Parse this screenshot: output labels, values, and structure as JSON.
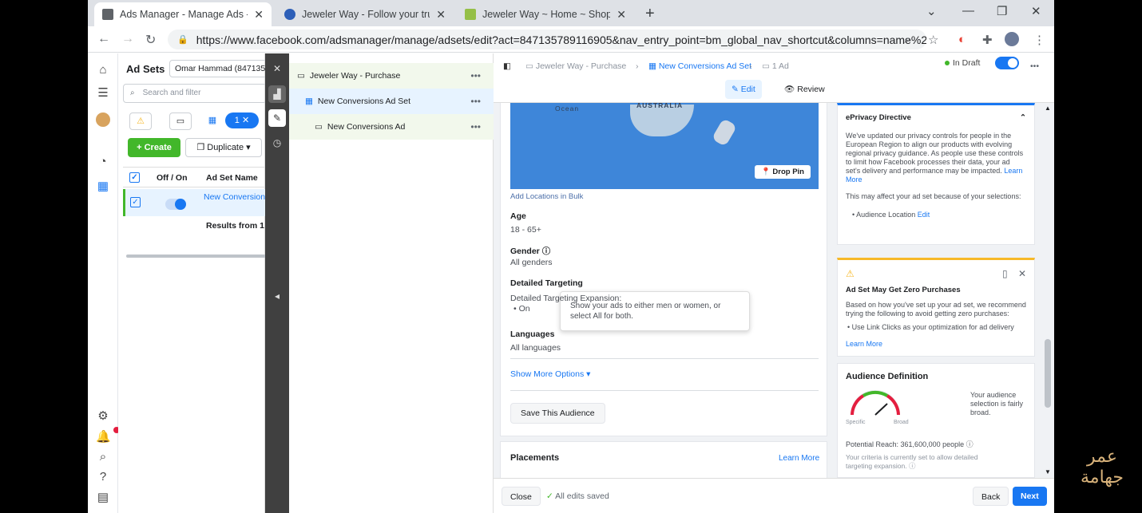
{
  "browser": {
    "tabs": [
      {
        "title": "Ads Manager - Manage Ads - Ad",
        "active": true
      },
      {
        "title": "Jeweler Way - Follow your true p",
        "active": false
      },
      {
        "title": "Jeweler Way ~ Home ~ Shopify",
        "active": false
      }
    ],
    "url": "https://www.facebook.com/adsmanager/manage/adsets/edit?act=847135789116905&nav_entry_point=bm_global_nav_shortcut&columns=name%2..."
  },
  "adsets_panel": {
    "title": "Ad Sets",
    "account": "Omar Hammad (8471357",
    "search_placeholder": "Search and filter",
    "filter_pill": "1",
    "create_label": "Create",
    "duplicate_label": "Duplicate",
    "col_off_on": "Off / On",
    "col_name": "Ad Set Name",
    "row_name": "New Conversion",
    "results": "Results from 1 a"
  },
  "tree": {
    "campaign": "Jeweler Way - Purchase",
    "adset": "New Conversions Ad Set",
    "ad": "New Conversions Ad"
  },
  "editor": {
    "crumb_campaign": "Jeweler Way - Purchase",
    "crumb_adset": "New Conversions Ad Set",
    "crumb_ad": "1 Ad",
    "status": "In Draft",
    "edit_label": "Edit",
    "review_label": "Review",
    "map_ocean": "Ocean",
    "map_australia": "AUSTRALIA",
    "drop_pin": "Drop Pin",
    "add_bulk": "Add Locations in Bulk",
    "age_label": "Age",
    "age_value": "18 - 65+",
    "gender_label": "Gender",
    "gender_value": "All genders",
    "gender_tooltip": "Show your ads to either men or women, or select All for both.",
    "detailed_label": "Detailed Targeting",
    "detailed_expansion": "Detailed Targeting Expansion:",
    "detailed_on": "On",
    "languages_label": "Languages",
    "languages_value": "All languages",
    "show_more": "Show More Options",
    "save_audience": "Save This Audience",
    "placements_label": "Placements",
    "placements_learn": "Learn More",
    "close_label": "Close",
    "saved_label": "All edits saved",
    "back_label": "Back",
    "next_label": "Next"
  },
  "sidebar_cards": {
    "eprivacy_title": "ePrivacy Directive",
    "eprivacy_body": "We've updated our privacy controls for people in the European Region to align our products with evolving regional privacy guidance. As people use these controls to limit how Facebook processes their data, your ad set's delivery and performance may be impacted.",
    "eprivacy_learn": "Learn More",
    "eprivacy_body2": "This may affect your ad set because of your selections:",
    "eprivacy_item": "Audience Location",
    "eprivacy_edit": "Edit",
    "zero_title": "Ad Set May Get Zero Purchases",
    "zero_body": "Based on how you've set up your ad set, we recommend trying the following to avoid getting zero purchases:",
    "zero_item": "Use Link Clicks as your optimization for ad delivery",
    "zero_learn": "Learn More",
    "aud_title": "Audience Definition",
    "aud_desc": "Your audience selection is fairly broad.",
    "aud_specific": "Specific",
    "aud_broad": "Broad",
    "reach": "Potential Reach: 361,600,000 people",
    "criteria": "Your criteria is currently set to allow detailed targeting expansion."
  },
  "watermark": {
    "line1": "عمر",
    "line2": "جهامة"
  },
  "colors": {
    "accent": "#1877f2",
    "create": "#42b72a",
    "warning": "#f7b928"
  }
}
